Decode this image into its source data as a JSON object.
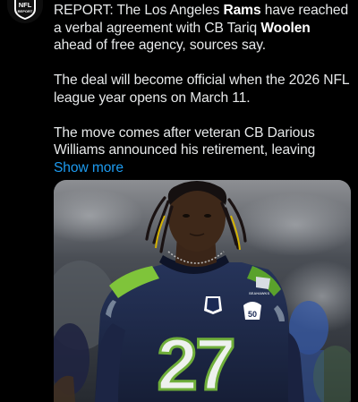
{
  "avatar": {
    "icon": "nfl-report-logo-icon",
    "logo_text_top": "NFL",
    "logo_text_bottom": "REPORT"
  },
  "tweet": {
    "p1_a": "REPORT: The Los Angeles ",
    "p1_bold_1": "Rams",
    "p1_b": " have reached a verbal agreement with CB Tariq ",
    "p1_bold_2": "Woolen",
    "p1_c": " ahead of free agency, sources say.",
    "p2": "The deal will become official when the 2026 NFL league year opens on March 11.",
    "p3": "The move comes after veteran CB Darious Williams announced his retirement, leaving ",
    "show_more": "Show more"
  },
  "media": {
    "jersey_number": "27",
    "jersey_brand": "SEAHAWKS",
    "patch_number": "50",
    "colors": {
      "jersey_navy": "#1f2a4a",
      "action_green": "#69be28",
      "number_fill": "#eef1ee"
    }
  },
  "colors": {
    "background": "#000000",
    "text": "#e7e9ea",
    "link": "#1d9bf0"
  }
}
